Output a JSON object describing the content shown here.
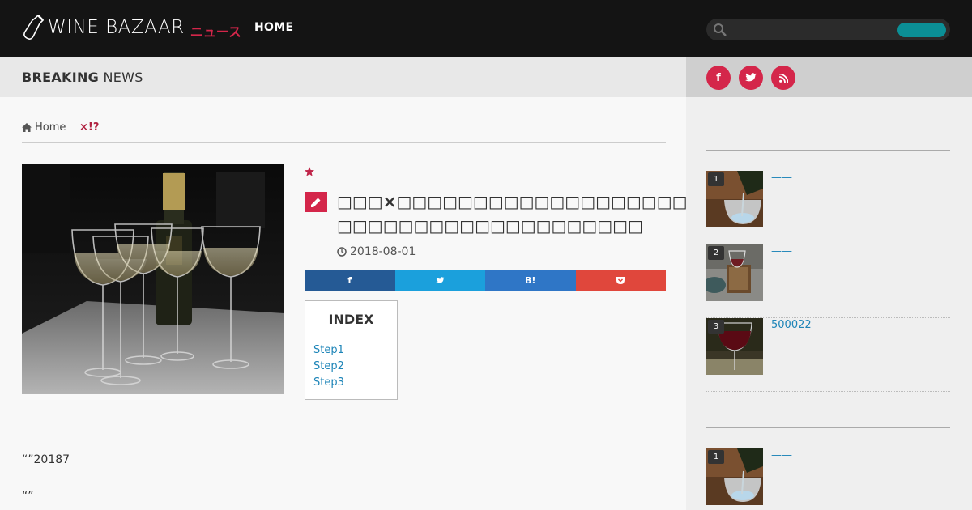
{
  "header": {
    "logo_text": "WINE BAZAAR",
    "logo_sub": "ニュース",
    "nav_home": "HOME",
    "search_placeholder": ""
  },
  "breaking": {
    "strong": "BREAKING",
    "rest": " NEWS"
  },
  "breadcrumb": {
    "home": "Home",
    "category": "×!?"
  },
  "article": {
    "title": "□□□×□□□□□□□□□□□□□□□□□□□□□□□□□□□□□□□□□□!?□□□□□□□□□□□□□□□□□□□□",
    "date": "2018-08-01",
    "share": [
      {
        "label": "f",
        "color": "#255a95"
      },
      {
        "label": "t",
        "color": "#1ba0dc"
      },
      {
        "label": "B!",
        "color": "#2f76c6"
      },
      {
        "label": "p",
        "color": "#e0473c"
      }
    ],
    "index": {
      "title": "INDEX",
      "items": [
        "Step1",
        "Step2",
        "Step3"
      ]
    },
    "paragraphs": [
      "“”20187",
      "“”"
    ]
  },
  "sidebar": {
    "ranking_1": [
      {
        "num": "1",
        "title": "——"
      },
      {
        "num": "2",
        "title": "——"
      },
      {
        "num": "3",
        "title": "500022——"
      }
    ],
    "ranking_2": [
      {
        "num": "1",
        "title": "——"
      }
    ]
  },
  "colors": {
    "accent": "#d4264a",
    "header_bg": "#141414",
    "link": "#1e85b8",
    "search_button": "#0b8f96"
  }
}
